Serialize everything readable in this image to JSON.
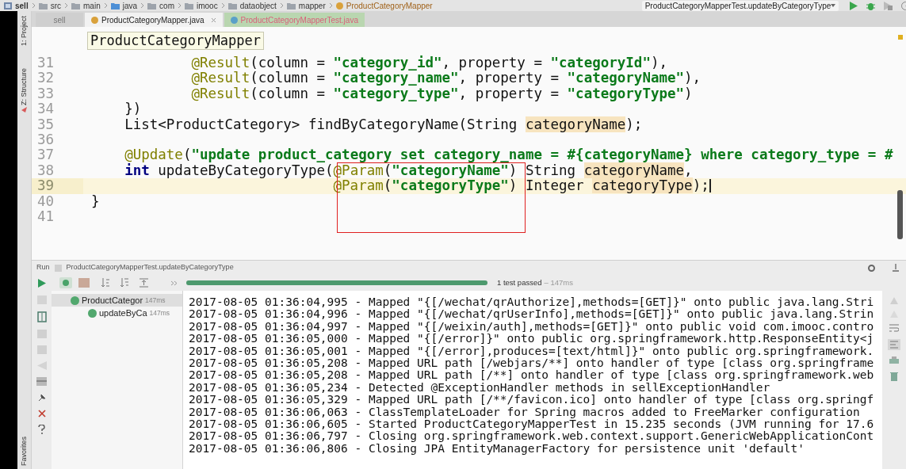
{
  "breadcrumbs": [
    {
      "label": "sell",
      "kind": "module"
    },
    {
      "label": "src",
      "kind": "folder"
    },
    {
      "label": "main",
      "kind": "folder"
    },
    {
      "label": "java",
      "kind": "source_folder"
    },
    {
      "label": "com",
      "kind": "folder"
    },
    {
      "label": "imooc",
      "kind": "folder"
    },
    {
      "label": "dataobject",
      "kind": "folder"
    },
    {
      "label": "mapper",
      "kind": "folder"
    },
    {
      "label": "ProductCategoryMapper",
      "kind": "class"
    }
  ],
  "run_config": {
    "label": "ProductCategoryMapperTest.updateByCategoryType"
  },
  "side_tabs": {
    "project": "1: Project",
    "structure": "Z: Structure",
    "favorites": "Favorites"
  },
  "tabs": [
    {
      "label": "sell",
      "kind": "module",
      "selected": false
    },
    {
      "label": "ProductCategoryMapper.java",
      "kind": "source",
      "selected": true
    },
    {
      "label": "ProductCategoryMapperTest.java",
      "kind": "test",
      "selected": false
    }
  ],
  "editor": {
    "tooltip": "ProductCategoryMapper",
    "annotation_box": true,
    "lines": [
      {
        "number": "31",
        "current": false,
        "segments": [
          {
            "kind": "annotation",
            "text": "            @Result"
          },
          {
            "kind": "plain",
            "text": "(column = "
          },
          {
            "kind": "string",
            "text": "\"category_id\""
          },
          {
            "kind": "plain",
            "text": ", property = "
          },
          {
            "kind": "string",
            "text": "\"categoryId\""
          },
          {
            "kind": "plain",
            "text": "),"
          }
        ]
      },
      {
        "number": "32",
        "current": false,
        "segments": [
          {
            "kind": "annotation",
            "text": "            @Result"
          },
          {
            "kind": "plain",
            "text": "(column = "
          },
          {
            "kind": "string",
            "text": "\"category_name\""
          },
          {
            "kind": "plain",
            "text": ", property = "
          },
          {
            "kind": "string",
            "text": "\"categoryName\""
          },
          {
            "kind": "plain",
            "text": "),"
          }
        ]
      },
      {
        "number": "33",
        "current": false,
        "segments": [
          {
            "kind": "annotation",
            "text": "            @Result"
          },
          {
            "kind": "plain",
            "text": "(column = "
          },
          {
            "kind": "string",
            "text": "\"category_type\""
          },
          {
            "kind": "plain",
            "text": ", property = "
          },
          {
            "kind": "string",
            "text": "\"categoryType\""
          },
          {
            "kind": "plain",
            "text": ")"
          }
        ]
      },
      {
        "number": "34",
        "current": false,
        "segments": [
          {
            "kind": "plain",
            "text": "    })"
          }
        ]
      },
      {
        "number": "35",
        "current": false,
        "segments": [
          {
            "kind": "plain",
            "text": "    List<ProductCategory> findByCategoryName(String "
          },
          {
            "kind": "usage",
            "text": "categoryName"
          },
          {
            "kind": "plain",
            "text": ");"
          }
        ]
      },
      {
        "number": "36",
        "current": false
      },
      {
        "number": "37",
        "current": false,
        "segments": [
          {
            "kind": "annotation",
            "text": "    @Update"
          },
          {
            "kind": "plain",
            "text": "("
          },
          {
            "kind": "string",
            "text": "\"update product_category set category_name = #{categoryName} where category_type = #"
          }
        ]
      },
      {
        "number": "38",
        "current": false,
        "segments": [
          {
            "kind": "keyword",
            "text": "    int"
          },
          {
            "kind": "plain",
            "text": " updateByCategoryType("
          },
          {
            "kind": "annotation",
            "text": "@Param"
          },
          {
            "kind": "plain",
            "text": "("
          },
          {
            "kind": "string",
            "text": "\"categoryName\""
          },
          {
            "kind": "plain",
            "text": ") String "
          },
          {
            "kind": "usage",
            "text": "categoryName"
          },
          {
            "kind": "plain",
            "text": ","
          }
        ]
      },
      {
        "number": "39",
        "current": true,
        "segments": [
          {
            "kind": "annotation",
            "text": "                             @Param"
          },
          {
            "kind": "plain",
            "text": "("
          },
          {
            "kind": "string",
            "text": "\"categoryType\""
          },
          {
            "kind": "plain",
            "text": ") Integer "
          },
          {
            "kind": "usage",
            "text": "categoryType"
          },
          {
            "kind": "plain",
            "text": ");"
          }
        ]
      },
      {
        "number": "40",
        "current": false,
        "segments": [
          {
            "kind": "plain",
            "text": "}"
          }
        ]
      },
      {
        "number": "41",
        "current": false
      }
    ]
  },
  "run_panel": {
    "title": "Run",
    "config": "ProductCategoryMapperTest.updateByCategoryType",
    "progress": {
      "level": 1
    },
    "status": "1 test passed",
    "duration": "– 147ms",
    "tree": [
      {
        "label": "ProductCategor",
        "time": "147ms",
        "selected": true,
        "children": [
          {
            "label": "updateByCa",
            "time": "147ms",
            "selected": false
          }
        ]
      }
    ],
    "console": [
      "2017-08-05 01:36:04,995 - Mapped \"{[/wechat/qrAuthorize],methods=[GET]}\" onto public java.lang.Stri",
      "2017-08-05 01:36:04,996 - Mapped \"{[/wechat/qrUserInfo],methods=[GET]}\" onto public java.lang.Strin",
      "2017-08-05 01:36:04,997 - Mapped \"{[/weixin/auth],methods=[GET]}\" onto public void com.imooc.contro",
      "2017-08-05 01:36:05,000 - Mapped \"{[/error]}\" onto public org.springframework.http.ResponseEntity<j",
      "2017-08-05 01:36:05,001 - Mapped \"{[/error],produces=[text/html]}\" onto public org.springframework.",
      "2017-08-05 01:36:05,208 - Mapped URL path [/webjars/**] onto handler of type [class org.springframe",
      "2017-08-05 01:36:05,208 - Mapped URL path [/**] onto handler of type [class org.springframework.web",
      "2017-08-05 01:36:05,234 - Detected @ExceptionHandler methods in sellExceptionHandler",
      "2017-08-05 01:36:05,329 - Mapped URL path [/**/favicon.ico] onto handler of type [class org.springf",
      "2017-08-05 01:36:06,063 - ClassTemplateLoader for Spring macros added to FreeMarker configuration",
      "2017-08-05 01:36:06,605 - Started ProductCategoryMapperTest in 15.235 seconds (JVM running for 17.6",
      "2017-08-05 01:36:06,797 - Closing org.springframework.web.context.support.GenericWebApplicationCont",
      "2017-08-05 01:36:06,806 - Closing JPA EntityManagerFactory for persistence unit 'default'"
    ]
  }
}
